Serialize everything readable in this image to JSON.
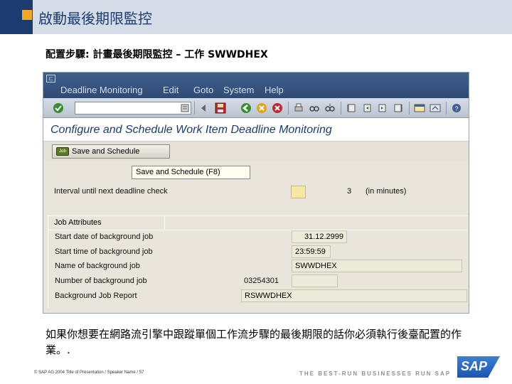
{
  "slide": {
    "title": "啟動最後期限監控",
    "subtitle": "配置步驟: 計畫最後期限監控 – 工作 SWWDHEX",
    "body": "如果你想要在網路流引擎中跟蹤單個工作流步驟的最後期限的話你必須執行後臺配置的作業。.",
    "footer": "SAP AG 2004 Title of Presentation / Speaker Name / 57",
    "tagline": "THE BEST-RUN BUSINESSES RUN SAP",
    "logo_text": "SAP",
    "accent_color": "#f5a623",
    "header_color": "#1c3b6e"
  },
  "sap": {
    "menu": [
      "Deadline Monitoring",
      "Edit",
      "Goto",
      "System",
      "Help"
    ],
    "screen_title": "Configure and Schedule Work Item Deadline Monitoring",
    "app_button": "Save and Schedule",
    "app_button_icon": "Job",
    "tooltip": "Save and Schedule  (F8)",
    "interval_label": "Interval until next deadline check",
    "interval_value": "3",
    "interval_unit": "(in minutes)",
    "group_title": "Job Attributes",
    "fields": [
      {
        "label": "Start date of background job",
        "value": "31.12.2999"
      },
      {
        "label": "Start time of background job",
        "value": "23:59:59"
      },
      {
        "label": "Name of background job",
        "value": "SWWDHEX"
      },
      {
        "label": "Number of background job",
        "value": "03254301"
      },
      {
        "label": "Background Job Report",
        "value": "RSWWDHEX"
      }
    ]
  }
}
